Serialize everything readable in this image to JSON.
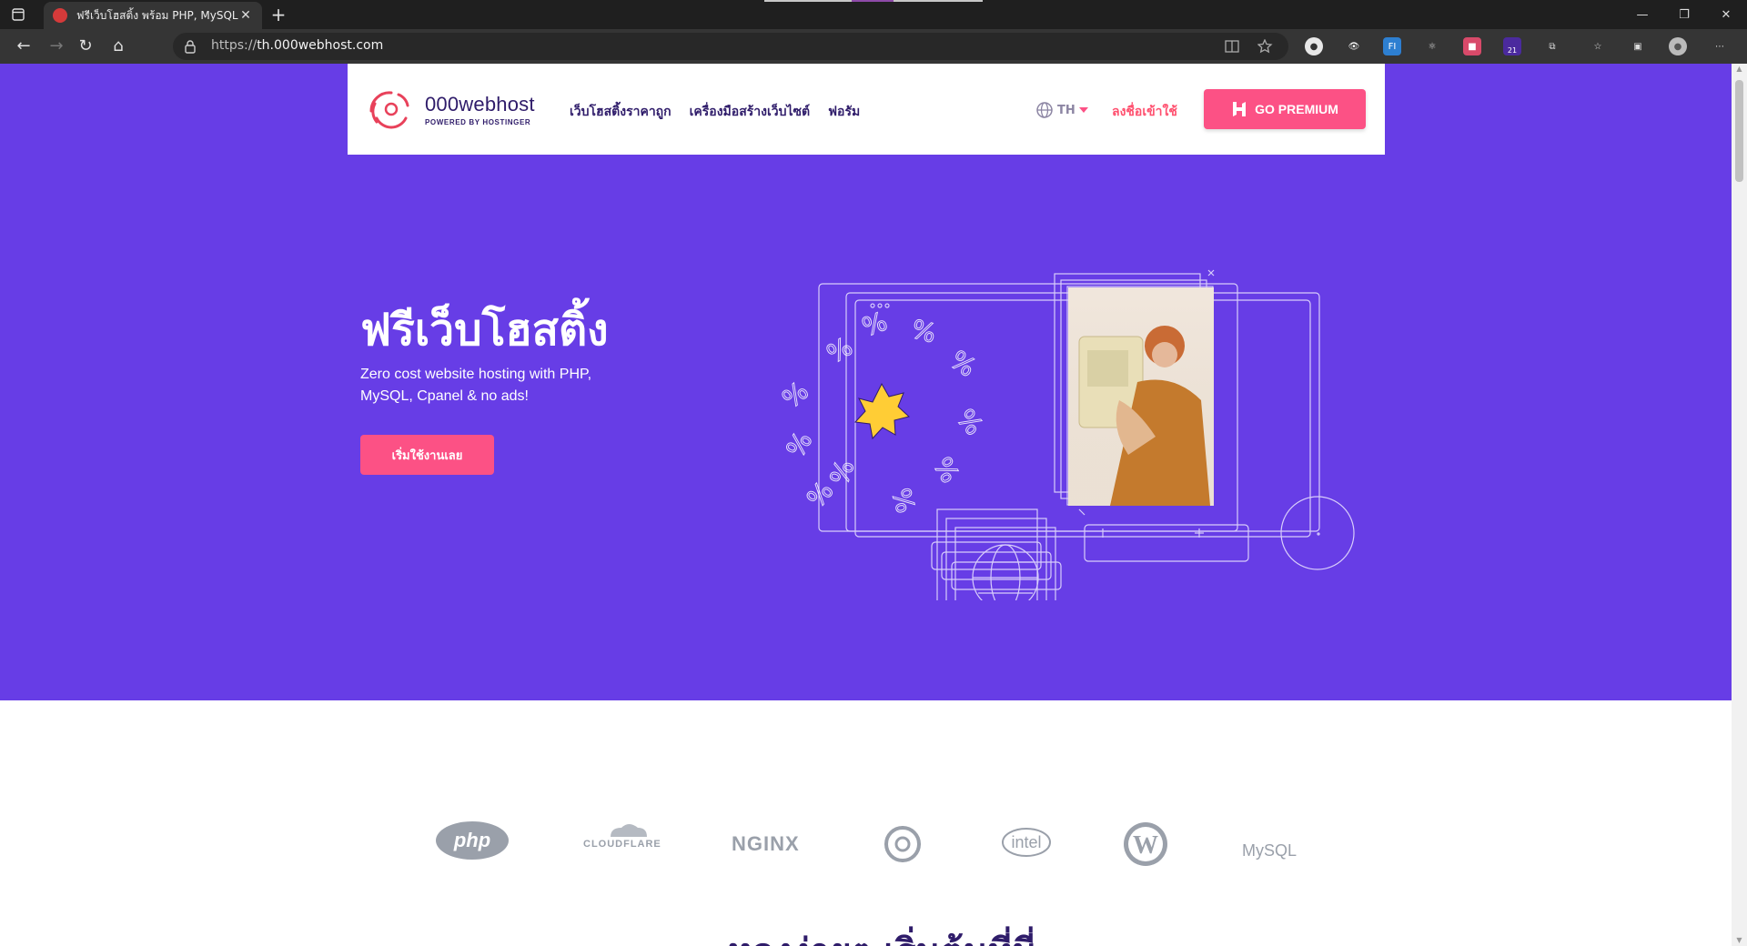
{
  "browser": {
    "tab_title": "ฟรีเว็บโฮสติ้ง พร้อม PHP, MySQL และ",
    "url_scheme": "https://",
    "url_host": "th.000webhost.com",
    "ext_badge_count": "21"
  },
  "site": {
    "brand_name": "000webhost",
    "brand_sub": "POWERED BY HOSTINGER",
    "menu": [
      "เว็บโฮสติ้งราคาถูก",
      "เครื่องมือสร้างเว็บไซต์",
      "ฟอรัม"
    ],
    "lang": "TH",
    "login": "ลงชื่อเข้าใช้",
    "premium": "GO PREMIUM",
    "accent": "#fc5185",
    "hero_bg": "#673de6"
  },
  "hero": {
    "title": "ฟรีเว็บโฮสติ้ง",
    "subtitle": "Zero cost website hosting with PHP, MySQL, Cpanel & no ads!",
    "cta": "เริ่มใช้งานเลย"
  },
  "partners": [
    "php",
    "CLOUDFLARE",
    "NGINX",
    "hostinger-swirl",
    "intel",
    "wordpress",
    "MySQL"
  ],
  "section_title_partial": "หลงง่ายๆ เริ่มต้นที่นี่"
}
